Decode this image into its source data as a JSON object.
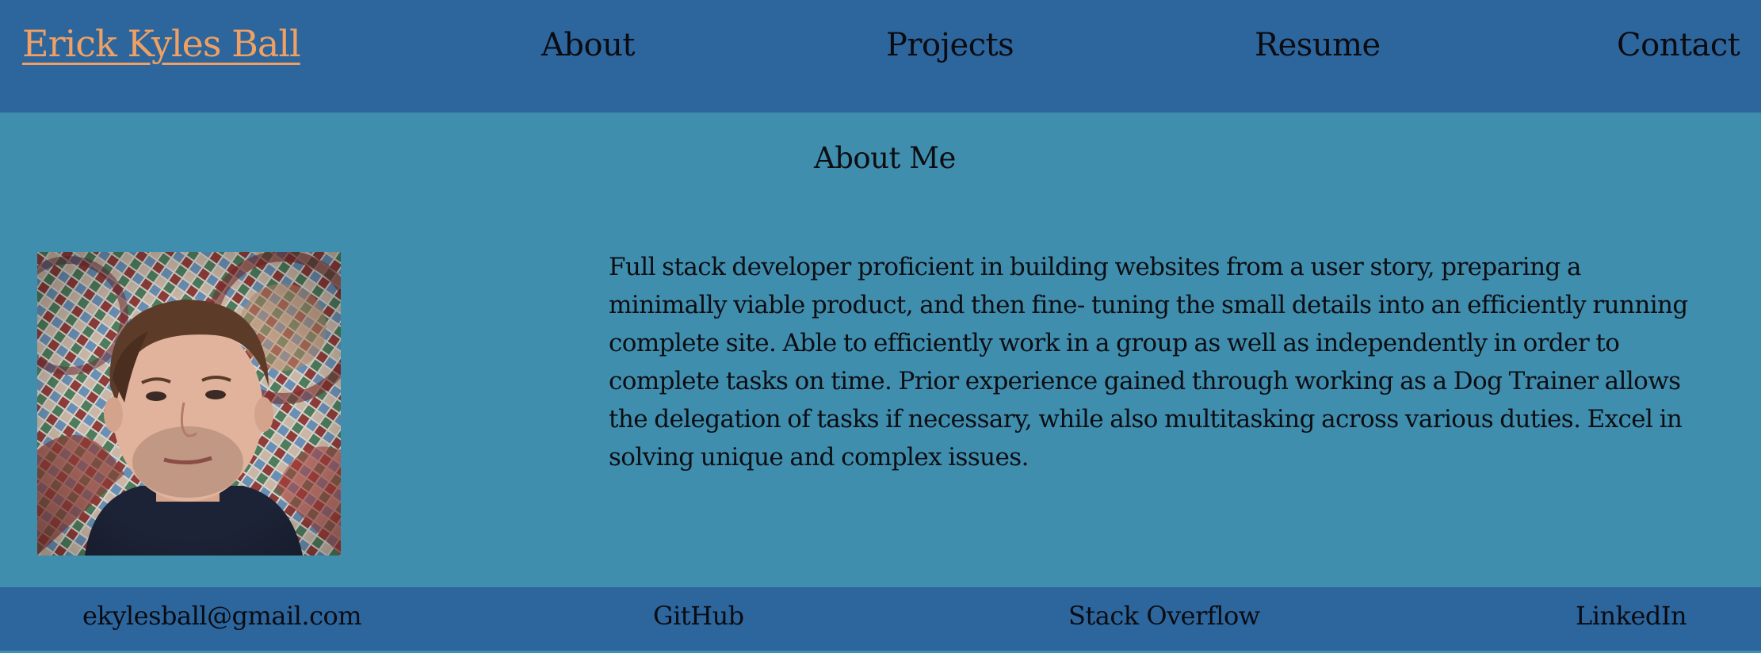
{
  "header": {
    "brand": "Erick Kyles Ball",
    "nav": {
      "about": "About",
      "projects": "Projects",
      "resume": "Resume",
      "contact": "Contact"
    }
  },
  "main": {
    "heading": "About Me",
    "photo_alt": "Photo of Erick Kyles Ball",
    "bio": "Full stack developer proficient in building websites from a user story, preparing a minimally viable product, and then fine- tuning the small details into an efficiently running complete site. Able to efficiently work in a group as well as independently in order to complete tasks on time. Prior experience gained through working as a Dog Trainer allows the delegation of tasks if necessary, while also multitasking across various duties. Excel in solving unique and complex issues."
  },
  "footer": {
    "email": "ekylesball@gmail.com",
    "github": "GitHub",
    "stackoverflow": "Stack Overflow",
    "linkedin": "LinkedIn"
  },
  "colors": {
    "header_bg": "#2c669d",
    "page_bg": "#3f8eae",
    "brand": "#f0a062",
    "text": "#0d0d12"
  }
}
